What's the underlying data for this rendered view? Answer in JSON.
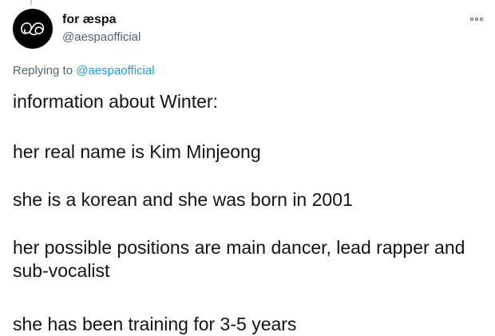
{
  "tweet": {
    "display_name": "for æspa",
    "handle": "@aespaofficial",
    "avatar_icon": "aespa-logo-icon",
    "more_icon": "more-options-icon",
    "replying_prefix": "Replying to ",
    "replying_to": "@aespaofficial",
    "mention_color": "#1d9bf0",
    "paragraphs": [
      "information about Winter:",
      "her real name is Kim Minjeong",
      "she is a korean and she was born in 2001",
      "her possible positions are main dancer, lead rapper and sub-vocalist",
      "she has been training for 3-5 years"
    ]
  }
}
